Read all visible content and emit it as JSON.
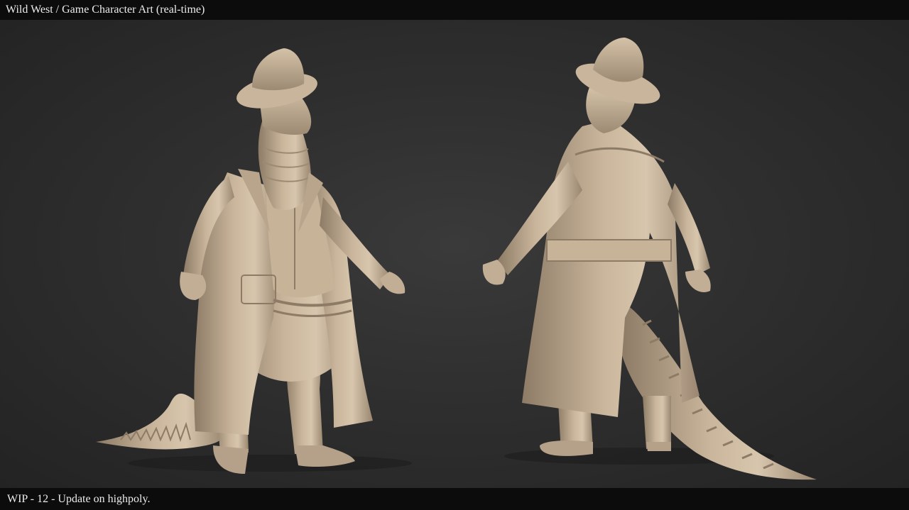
{
  "header": {
    "title": "Wild West / Game Character Art (real-time)"
  },
  "footer": {
    "caption": "WIP - 12 - Update on highpoly."
  },
  "scene": {
    "subject": "two-views-of-sculpted-crocodile-cowboy",
    "clay_color": "#c2ae94",
    "clay_shadow": "#8d7b66",
    "clay_highlight": "#ddcdb5"
  }
}
